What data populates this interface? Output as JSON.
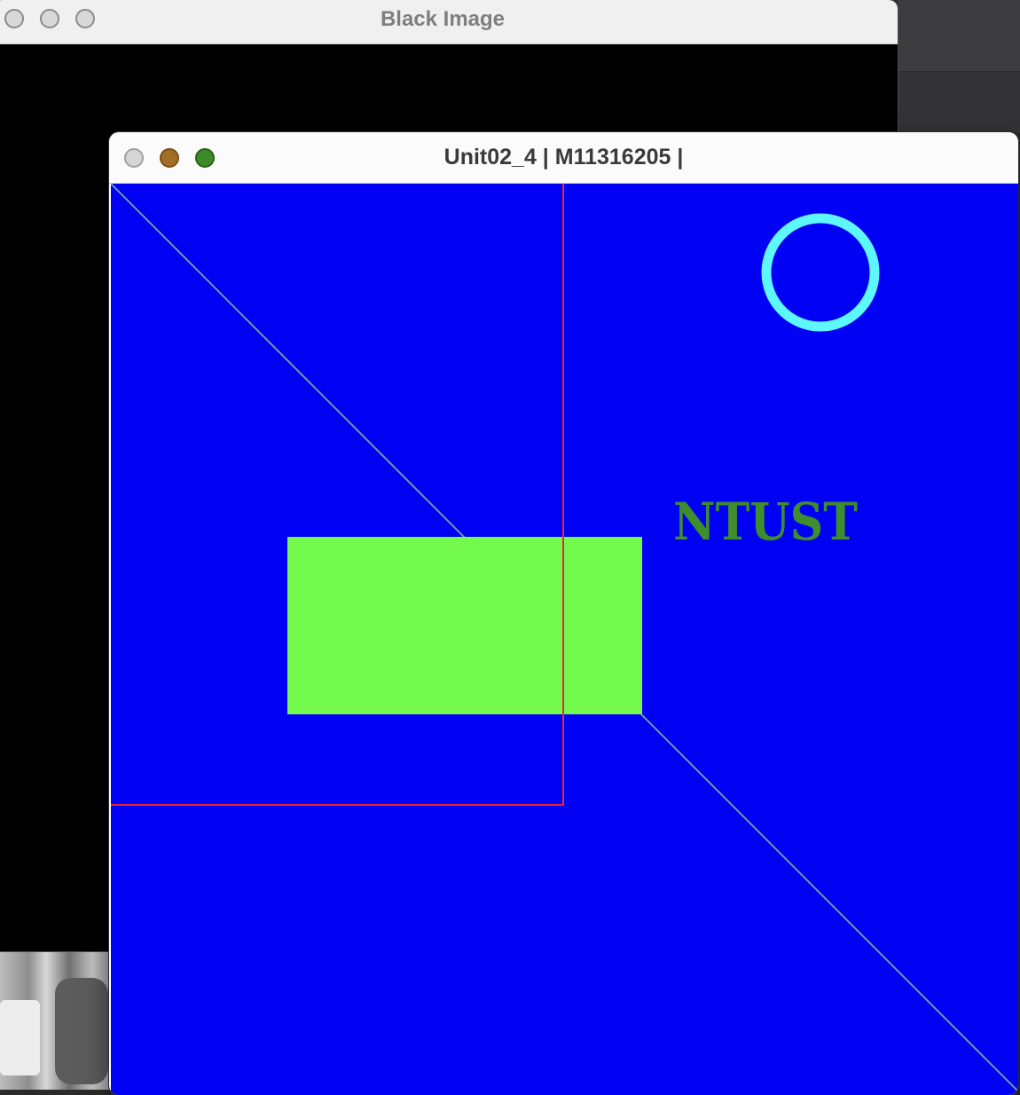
{
  "background_window": {
    "title": "Black Image",
    "traffic_lights": [
      "close",
      "minimize",
      "zoom"
    ]
  },
  "front_window": {
    "title": "Unit02_4 | M11316205 |",
    "traffic_lights": [
      "close",
      "minimize",
      "zoom"
    ],
    "canvas": {
      "background": "#0000f5",
      "text_label": "NTUST",
      "text_color": "#3e8e2c",
      "rect_fill": "#74fa4c",
      "circle_color": "#5cf6fb",
      "red_frame_color": "#e5283a",
      "diagonal_color": "#6a9ab0"
    }
  }
}
